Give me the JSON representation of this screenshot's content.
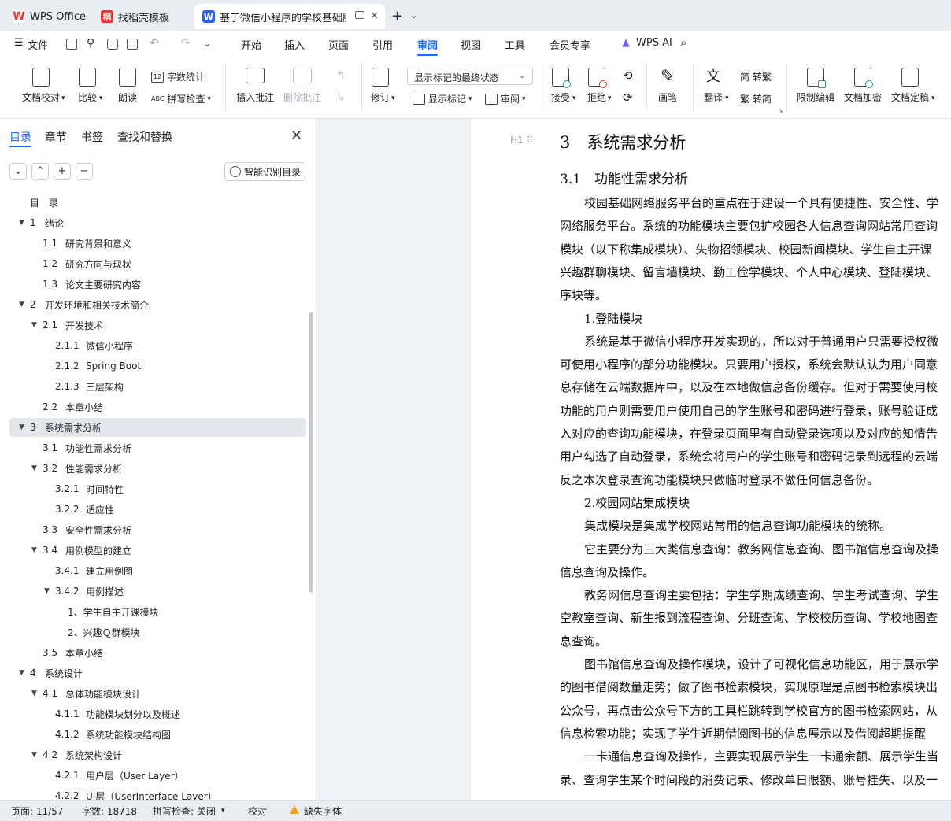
{
  "tabs": [
    {
      "label": "WPS Office",
      "icon": "wps-logo-icon",
      "color": "#e8372c"
    },
    {
      "label": "找稻壳模板",
      "icon": "docer-icon",
      "color": "#e8372c"
    },
    {
      "label": "基于微信小程序的学校基础服务",
      "icon": "word-doc-icon",
      "color": "#2b63e8"
    }
  ],
  "menubar": {
    "file": "文件",
    "items": [
      "开始",
      "插入",
      "页面",
      "引用",
      "审阅",
      "视图",
      "工具",
      "会员专享"
    ],
    "active": "审阅",
    "wps_ai": "WPS AI"
  },
  "ribbon": {
    "doc_proofread": "文档校对",
    "compare": "比较",
    "read_aloud": "朗读",
    "word_count": "字数统计",
    "spell_check": "拼写检查",
    "insert_comment": "插入批注",
    "delete_comment": "删除批注",
    "track_changes": "修订",
    "markup_state": "显示标记的最终状态",
    "show_markup": "显示标记",
    "review": "审阅",
    "accept": "接受",
    "reject": "拒绝",
    "pen": "画笔",
    "translate": "翻译",
    "to_traditional": "转繁",
    "to_simplified": "转简",
    "restrict_edit": "限制编辑",
    "encrypt": "文档加密",
    "finalize": "文档定稿"
  },
  "nav": {
    "tabs": [
      "目录",
      "章节",
      "书签",
      "查找和替换"
    ],
    "smart_toc": "智能识别目录",
    "toc": [
      {
        "num": "",
        "text": "目　录",
        "level": 0,
        "arrow": false
      },
      {
        "num": "1",
        "text": "绪论",
        "level": 1,
        "arrow": true
      },
      {
        "num": "1.1",
        "text": "研究背景和意义",
        "level": 2,
        "arrow": false
      },
      {
        "num": "1.2",
        "text": "研究方向与现状",
        "level": 2,
        "arrow": false
      },
      {
        "num": "1.3",
        "text": "论文主要研究内容",
        "level": 2,
        "arrow": false
      },
      {
        "num": "2",
        "text": "开发环境和相关技术简介",
        "level": 1,
        "arrow": true
      },
      {
        "num": "2.1",
        "text": "开发技术",
        "level": 2,
        "arrow": true
      },
      {
        "num": "2.1.1",
        "text": "微信小程序",
        "level": 3,
        "arrow": false
      },
      {
        "num": "2.1.2",
        "text": "Spring Boot",
        "level": 3,
        "arrow": false
      },
      {
        "num": "2.1.3",
        "text": "三层架构",
        "level": 3,
        "arrow": false
      },
      {
        "num": "2.2",
        "text": "本章小结",
        "level": 2,
        "arrow": false
      },
      {
        "num": "3",
        "text": "系统需求分析",
        "level": 1,
        "arrow": true,
        "selected": true
      },
      {
        "num": "3.1",
        "text": "功能性需求分析",
        "level": 2,
        "arrow": false
      },
      {
        "num": "3.2",
        "text": "性能需求分析",
        "level": 2,
        "arrow": true
      },
      {
        "num": "3.2.1",
        "text": "时间特性",
        "level": 3,
        "arrow": false
      },
      {
        "num": "3.2.2",
        "text": "适应性",
        "level": 3,
        "arrow": false
      },
      {
        "num": "3.3",
        "text": "安全性需求分析",
        "level": 2,
        "arrow": false
      },
      {
        "num": "3.4",
        "text": "用例模型的建立",
        "level": 2,
        "arrow": true
      },
      {
        "num": "3.4.1",
        "text": "建立用例图",
        "level": 3,
        "arrow": false
      },
      {
        "num": "3.4.2",
        "text": "用例描述",
        "level": 3,
        "arrow": true
      },
      {
        "num": "",
        "text": "1、学生自主开课模块",
        "level": 4,
        "arrow": false
      },
      {
        "num": "",
        "text": "2、兴趣Ｑ群模块",
        "level": 4,
        "arrow": false
      },
      {
        "num": "3.5",
        "text": "本章小结",
        "level": 2,
        "arrow": false
      },
      {
        "num": "4",
        "text": "系统设计",
        "level": 1,
        "arrow": true
      },
      {
        "num": "4.1",
        "text": "总体功能模块设计",
        "level": 2,
        "arrow": true
      },
      {
        "num": "4.1.1",
        "text": "功能模块划分以及概述",
        "level": 3,
        "arrow": false
      },
      {
        "num": "4.1.2",
        "text": "系统功能模块结构图",
        "level": 3,
        "arrow": false
      },
      {
        "num": "4.2",
        "text": "系统架构设计",
        "level": 2,
        "arrow": true
      },
      {
        "num": "4.2.1",
        "text": "用户层（User Layer）",
        "level": 3,
        "arrow": false
      },
      {
        "num": "4.2.2",
        "text": "UI层（UserInterface Layer）",
        "level": 3,
        "arrow": false
      }
    ]
  },
  "document": {
    "heading1": "3　系统需求分析",
    "heading2": "3.1　功能性需求分析",
    "h1_marker": "H1",
    "lines": [
      {
        "text": "校园基础网络服务平台的重点在于建设一个具有便捷性、安全性、学",
        "indent": true
      },
      {
        "text": "网络服务平台。系统的功能模块主要包扩校园各大信息查询网站常用查询",
        "indent": false
      },
      {
        "text": "模块（以下称集成模块）、失物招领模块、校园新闻模块、学生自主开课",
        "indent": false
      },
      {
        "text": "兴趣群聊模块、留言墙模块、勤工俭学模块、个人中心模块、登陆模块、",
        "indent": false
      },
      {
        "text": "序块等。",
        "indent": false
      },
      {
        "text": "1.登陆模块",
        "indent": true
      },
      {
        "text": "系统是基于微信小程序开发实现的，所以对于普通用户只需要授权微",
        "indent": true
      },
      {
        "text": "可使用小程序的部分功能模块。只要用户授权，系统会默认认为用户同意",
        "indent": false
      },
      {
        "text": "息存储在云端数据库中，以及在本地做信息备份缓存。但对于需要使用校",
        "indent": false
      },
      {
        "text": "功能的用户则需要用户使用自己的学生账号和密码进行登录，账号验证成",
        "indent": false
      },
      {
        "text": "入对应的查询功能模块，在登录页面里有自动登录选项以及对应的知情告",
        "indent": false
      },
      {
        "text": "用户勾选了自动登录，系统会将用户的学生账号和密码记录到远程的云端",
        "indent": false
      },
      {
        "text": "反之本次登录查询功能模块只做临时登录不做任何信息备份。",
        "indent": false
      },
      {
        "text": "2.校园网站集成模块",
        "indent": true
      },
      {
        "text": "集成模块是集成学校网站常用的信息查询功能模块的统称。",
        "indent": true
      },
      {
        "text": "它主要分为三大类信息查询：教务网信息查询、图书馆信息查询及操",
        "indent": true
      },
      {
        "text": "信息查询及操作。",
        "indent": false
      },
      {
        "text": "教务网信息查询主要包括：学生学期成绩查询、学生考试查询、学生",
        "indent": true
      },
      {
        "text": "空教室查询、新生报到流程查询、分班查询、学校校历查询、学校地图查",
        "indent": false
      },
      {
        "text": "息查询。",
        "indent": false
      },
      {
        "text": "图书馆信息查询及操作模块，设计了可视化信息功能区，用于展示学",
        "indent": true
      },
      {
        "text": "的图书借阅数量走势；做了图书检索模块，实现原理是点图书检索模块出",
        "indent": false
      },
      {
        "text": "公众号，再点击公众号下方的工具栏跳转到学校官方的图书检索网站，从",
        "indent": false
      },
      {
        "text": "信息检索功能；实现了学生近期借阅图书的信息展示以及借阅超期提醒",
        "indent": false
      },
      {
        "text": "一卡通信息查询及操作，主要实现展示学生一卡通余额、展示学生当",
        "indent": true
      },
      {
        "text": "录、查询学生某个时间段的消费记录、修改单日限额、账号挂失、以及一",
        "indent": false
      }
    ]
  },
  "status": {
    "page": "页面: 11/57",
    "words": "字数: 18718",
    "spell": "拼写检查: 关闭",
    "proof": "校对",
    "missing_font": "缺失字体"
  }
}
